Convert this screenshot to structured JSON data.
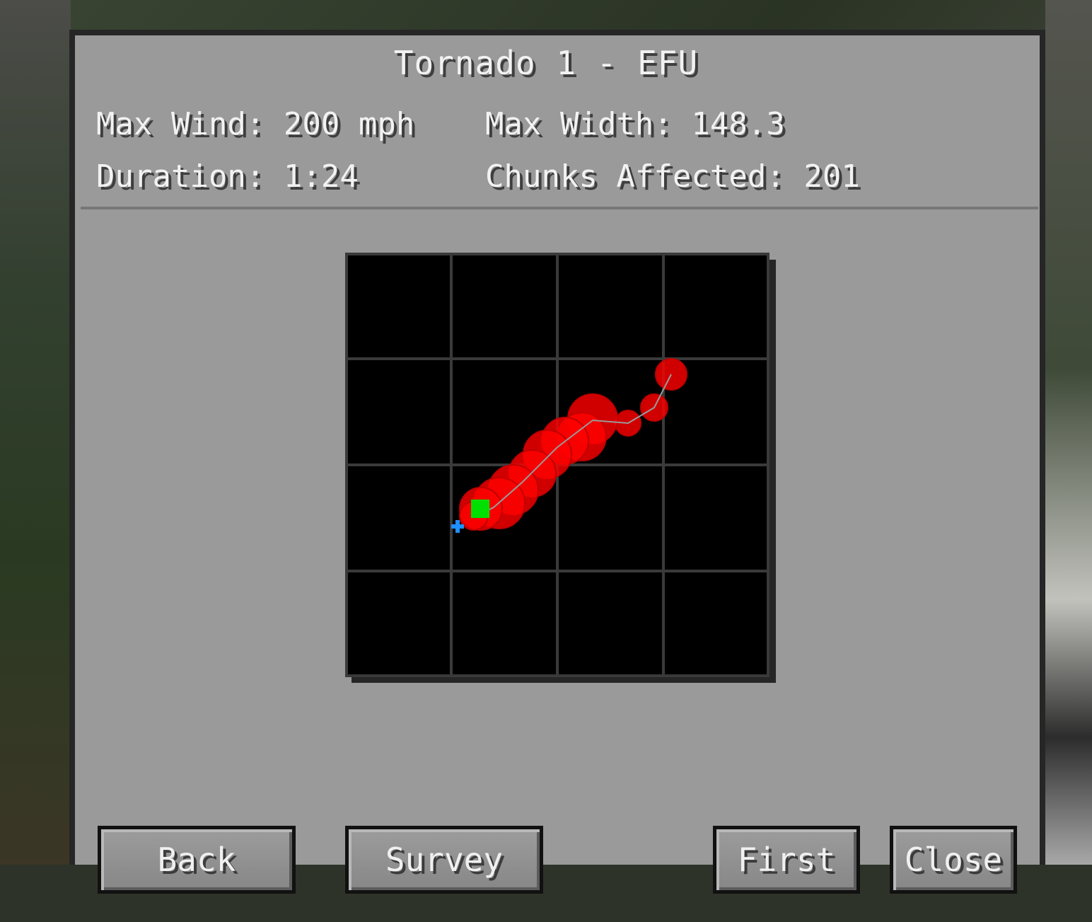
{
  "dialog": {
    "title": "Tornado 1 - EFU",
    "stats": {
      "max_wind": "Max Wind: 200 mph",
      "max_width": "Max Width: 148.3",
      "duration": "Duration: 1:24",
      "chunks_affected": "Chunks Affected: 201"
    }
  },
  "map": {
    "grid_divisions": 4,
    "background_color": "#000000",
    "grid_color": "#3a3a3a",
    "damage_color": "#ff0000",
    "track_color": "#9a9a9a",
    "marker_color": "#00e000",
    "player_color": "#1e90ff"
  },
  "buttons": {
    "back": "Back",
    "survey": "Survey",
    "first": "First",
    "close": "Close"
  }
}
